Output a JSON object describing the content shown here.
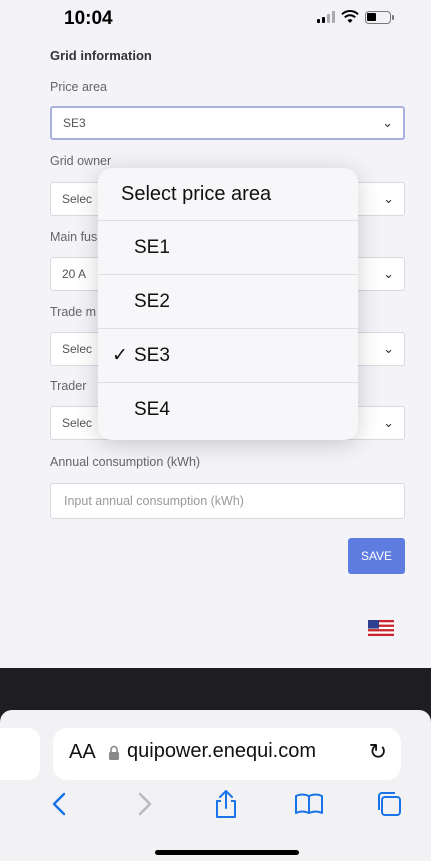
{
  "status": {
    "time": "10:04"
  },
  "form": {
    "section_title": "Grid information",
    "price_area": {
      "label": "Price area",
      "value": "SE3"
    },
    "grid_owner": {
      "label": "Grid owner",
      "value": "Selec"
    },
    "main_fuse": {
      "label": "Main fus",
      "value": "20 A"
    },
    "trade_method": {
      "label": "Trade m",
      "value": "Selec"
    },
    "trader": {
      "label": "Trader",
      "value": "Selec"
    },
    "annual_consumption": {
      "label": "Annual consumption (kWh)",
      "placeholder": "Input annual consumption (kWh)"
    },
    "save_label": "SAVE"
  },
  "dropdown": {
    "title": "Select price area",
    "options": [
      {
        "label": "SE1",
        "checked": false
      },
      {
        "label": "SE2",
        "checked": false
      },
      {
        "label": "SE3",
        "checked": true
      },
      {
        "label": "SE4",
        "checked": false
      }
    ],
    "check_mark": "✓"
  },
  "browser": {
    "aa": "AA",
    "url": "quipower.enequi.com"
  },
  "colors": {
    "accent": "#5f7de0",
    "focus_border": "#a7b0e0",
    "dark_band": "#1e1e20",
    "ios_blue": "#1a73e8"
  },
  "icons": [
    "signal-icon",
    "wifi-icon",
    "battery-icon",
    "chevron-down-icon",
    "us-flag-icon",
    "lock-icon",
    "reload-icon",
    "back-icon",
    "forward-icon",
    "share-icon",
    "bookmarks-icon",
    "tabs-icon"
  ]
}
